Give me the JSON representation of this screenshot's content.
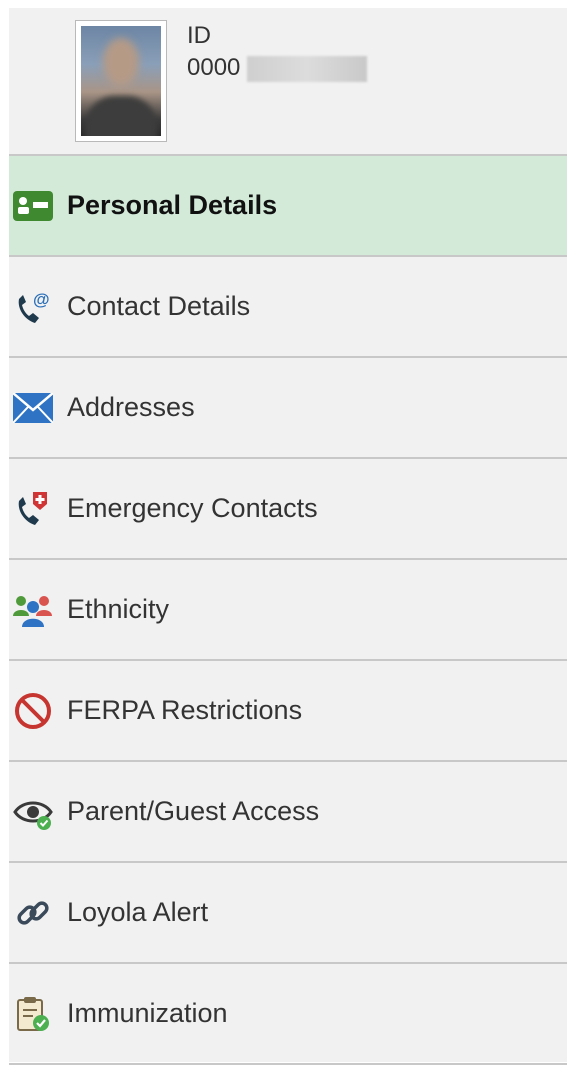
{
  "profile": {
    "id_label": "ID",
    "id_value": "0000"
  },
  "nav": {
    "items": [
      {
        "label": "Personal Details",
        "icon": "id-card-icon",
        "active": true
      },
      {
        "label": "Contact Details",
        "icon": "phone-email-icon"
      },
      {
        "label": "Addresses",
        "icon": "envelope-icon"
      },
      {
        "label": "Emergency Contacts",
        "icon": "emergency-phone-icon"
      },
      {
        "label": "Ethnicity",
        "icon": "people-icon"
      },
      {
        "label": "FERPA Restrictions",
        "icon": "prohibited-icon"
      },
      {
        "label": "Parent/Guest Access",
        "icon": "eye-check-icon"
      },
      {
        "label": "Loyola Alert",
        "icon": "link-icon"
      },
      {
        "label": "Immunization",
        "icon": "clipboard-check-icon"
      }
    ]
  },
  "colors": {
    "active_bg": "#d3ead9",
    "panel_bg": "#f1f1f1",
    "divider": "#c8c8c8"
  }
}
